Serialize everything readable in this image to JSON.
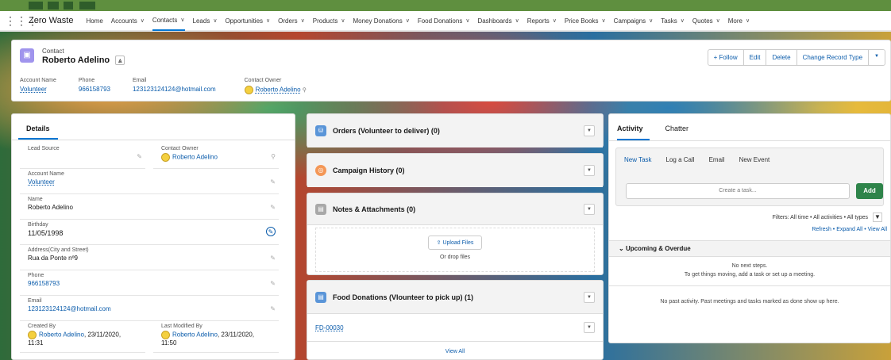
{
  "app": {
    "name": "Zero Waste"
  },
  "nav": [
    {
      "label": "Home",
      "chevron": false
    },
    {
      "label": "Accounts",
      "chevron": true
    },
    {
      "label": "Contacts",
      "chevron": true,
      "active": true
    },
    {
      "label": "Leads",
      "chevron": true
    },
    {
      "label": "Opportunities",
      "chevron": true
    },
    {
      "label": "Orders",
      "chevron": true
    },
    {
      "label": "Products",
      "chevron": true
    },
    {
      "label": "Money Donations",
      "chevron": true
    },
    {
      "label": "Food Donations",
      "chevron": true
    },
    {
      "label": "Dashboards",
      "chevron": true
    },
    {
      "label": "Reports",
      "chevron": true
    },
    {
      "label": "Price Books",
      "chevron": true
    },
    {
      "label": "Campaigns",
      "chevron": true
    },
    {
      "label": "Tasks",
      "chevron": true
    },
    {
      "label": "Quotes",
      "chevron": true
    },
    {
      "label": "More",
      "chevron": true
    }
  ],
  "header": {
    "type": "Contact",
    "name": "Roberto Adelino",
    "buttons": {
      "follow": "+ Follow",
      "edit": "Edit",
      "delete": "Delete",
      "change": "Change Record Type",
      "more": "▼"
    },
    "fields": {
      "account_label": "Account Name",
      "account_value": "Volunteer",
      "phone_label": "Phone",
      "phone_value": "966158793",
      "email_label": "Email",
      "email_value": "123123124124@hotmail.com",
      "owner_label": "Contact Owner",
      "owner_value": "Roberto Adelino"
    }
  },
  "details": {
    "tab": "Details",
    "lead_source_label": "Lead Source",
    "lead_source_value": "",
    "contact_owner_label": "Contact Owner",
    "contact_owner_value": "Roberto Adelino",
    "account_label": "Account Name",
    "account_value": "Volunteer",
    "name_label": "Name",
    "name_value": "Roberto Adelino",
    "birthday_label": "Birthday",
    "birthday_value": "11/05/1998",
    "address_label": "Address(City and Street)",
    "address_value": "Rua da Ponte nº9",
    "phone_label": "Phone",
    "phone_value": "966158793",
    "email_label": "Email",
    "email_value": "123123124124@hotmail.com",
    "created_label": "Created By",
    "created_user": "Roberto Adelino",
    "created_date": ", 23/11/2020,",
    "created_time": "11:31",
    "modified_label": "Last Modified By",
    "modified_user": "Roberto Adelino",
    "modified_date": ", 23/11/2020,",
    "modified_time": "11:50"
  },
  "related": {
    "orders_title": "Orders (Volunteer to deliver) (0)",
    "campaign_title": "Campaign History (0)",
    "notes_title": "Notes & Attachments (0)",
    "upload_label": "Upload Files",
    "drop_label": "Or drop files",
    "food_title": "Food Donations (Vlounteer to pick up) (1)",
    "food_item": "FD-00030",
    "view_all": "View All"
  },
  "activity": {
    "tab_activity": "Activity",
    "tab_chatter": "Chatter",
    "sub_tabs": [
      "New Task",
      "Log a Call",
      "Email",
      "New Event"
    ],
    "task_placeholder": "Create a task...",
    "add_label": "Add",
    "filters": "Filters: All time • All activities • All types",
    "refresh": "Refresh • Expand All • View All",
    "upcoming": "Upcoming & Overdue",
    "no_steps_1": "No next steps.",
    "no_steps_2": "To get things moving, add a task or set up a meeting.",
    "no_past": "No past activity. Past meetings and tasks marked as done show up here."
  },
  "colors": {
    "accent": "#0176d3",
    "link": "#0b5cab",
    "contact_icon": "#a094ed",
    "add_button": "#2e844a"
  }
}
